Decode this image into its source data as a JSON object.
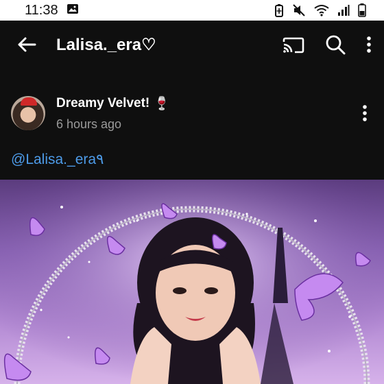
{
  "status_bar": {
    "time": "11:38",
    "icons": [
      "image-icon",
      "battery-saver-icon",
      "mute-icon",
      "wifi-icon",
      "signal-icon",
      "battery-icon"
    ]
  },
  "app_bar": {
    "title": "Lalisa._era♡",
    "icons": [
      "back-arrow-icon",
      "cast-icon",
      "search-icon",
      "more-vert-icon"
    ]
  },
  "post": {
    "author": "Dreamy Velvet!",
    "author_emoji": "🍷",
    "time": "6 hours ago",
    "mention": "@Lalisa._era٩"
  },
  "colors": {
    "background": "#0f0f0f",
    "mention": "#4d9be8",
    "subtext": "#9a9a9a"
  }
}
